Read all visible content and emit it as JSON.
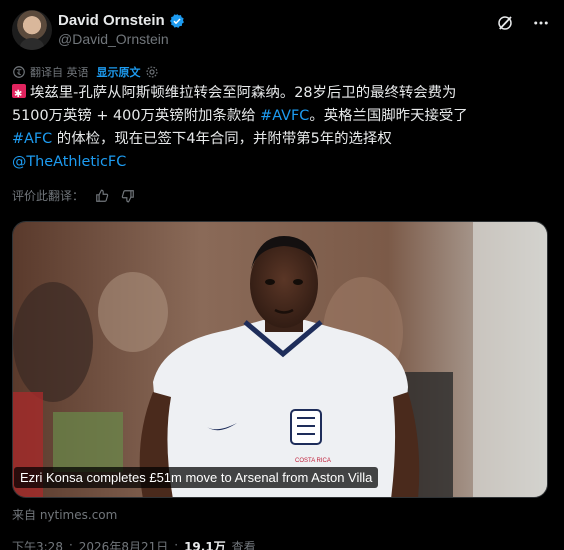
{
  "author": {
    "display_name": "David Ornstein",
    "handle": "@David_Ornstein",
    "verified": true
  },
  "translation": {
    "label": "翻译自 英语",
    "show_original": "显示原文"
  },
  "tweet": {
    "line1": "埃兹里-孔萨从阿斯顿维拉转会至阿森纳。28岁后卫的最终转会费为",
    "line2a": "5100万英镑 + 400万英镑附加条款给 ",
    "hashtag1": "#AVFC",
    "line2b": "。英格兰国脚昨天接受了",
    "hashtag2": "#AFC",
    "line3": " 的体检，现在已签下4年合同，并附带第5年的选择权",
    "mention": "@TheAthleticFC"
  },
  "rate_translation": {
    "label": "评价此翻译："
  },
  "media": {
    "caption": "Ezri Konsa completes £51m move to Arsenal from Aston Villa",
    "shirt_text": "COSTA RICA"
  },
  "source": "来自 nytimes.com",
  "meta": {
    "time": "下午3:28",
    "date": "2026年8月21日",
    "separator": "·",
    "views_count": "19.1万",
    "views_label": "查看"
  },
  "colors": {
    "accent": "#1d9bf0",
    "muted": "#71767b",
    "text": "#e7e9ea",
    "background": "#000000"
  },
  "icons": [
    "verified-badge-icon",
    "grok-icon",
    "more-icon",
    "translate-icon",
    "gear-icon",
    "thumbs-up-icon",
    "thumbs-down-icon"
  ]
}
